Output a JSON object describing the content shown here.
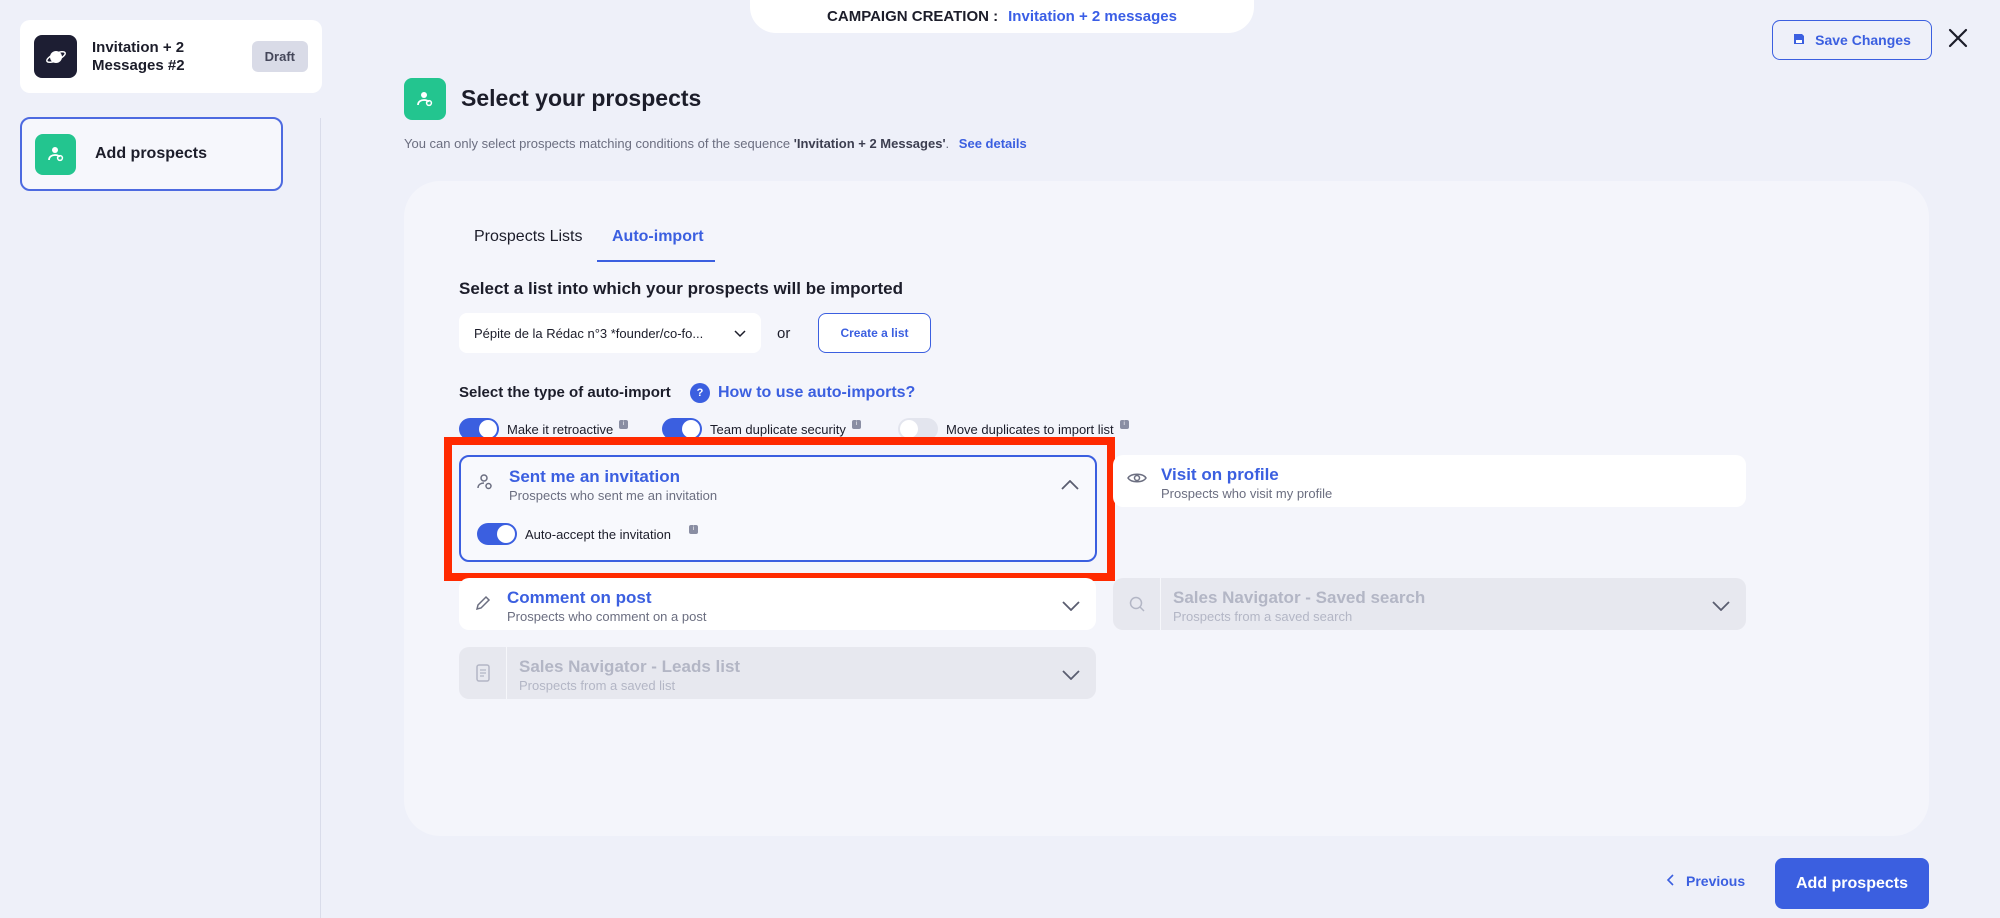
{
  "banner": {
    "label": "CAMPAIGN CREATION :",
    "value": "Invitation + 2 messages"
  },
  "sidebar": {
    "campaign_name": "Invitation + 2 Messages #2",
    "status": "Draft",
    "steps": [
      {
        "label": "Add prospects"
      }
    ]
  },
  "header": {
    "save_label": "Save Changes"
  },
  "page": {
    "title": "Select your prospects",
    "note_prefix": "You can only select prospects matching conditions of the sequence ",
    "note_sequence": "'Invitation + 2 Messages'",
    "note_suffix": ".",
    "note_link": "See details"
  },
  "tabs": [
    {
      "label": "Prospects Lists",
      "active": false
    },
    {
      "label": "Auto-import",
      "active": true
    }
  ],
  "import_list": {
    "title": "Select a list into which your prospects will be imported",
    "selected": "Pépite de la Rédac n°3 *founder/co-fo...",
    "or": "or",
    "create_label": "Create a list"
  },
  "auto_import": {
    "title": "Select the type of auto-import",
    "help_link": "How to use auto-imports?",
    "toggles": [
      {
        "label": "Make it retroactive",
        "on": true
      },
      {
        "label": "Team duplicate security",
        "on": true
      },
      {
        "label": "Move duplicates to import list",
        "on": false
      }
    ],
    "options": [
      {
        "title": "Sent me an invitation",
        "subtitle": "Prospects who sent me an invitation",
        "icon": "user-invite-icon",
        "expanded": true,
        "sub_toggle": {
          "label": "Auto-accept the invitation",
          "on": true
        }
      },
      {
        "title": "Visit on profile",
        "subtitle": "Prospects who visit my profile",
        "icon": "eye-icon"
      },
      {
        "title": "Comment on post",
        "subtitle": "Prospects who comment on a post",
        "icon": "pencil-icon"
      },
      {
        "title": "Sales Navigator - Saved search",
        "subtitle": "Prospects from a saved search",
        "icon": "search-icon",
        "disabled": true
      },
      {
        "title": "Sales Navigator - Leads list",
        "subtitle": "Prospects from a saved list",
        "icon": "document-icon",
        "disabled": true
      }
    ]
  },
  "footer": {
    "previous_label": "Previous",
    "add_label": "Add prospects"
  },
  "colors": {
    "accent": "#3b5fe0",
    "green": "#23c58f",
    "highlight": "#ff2a00"
  }
}
